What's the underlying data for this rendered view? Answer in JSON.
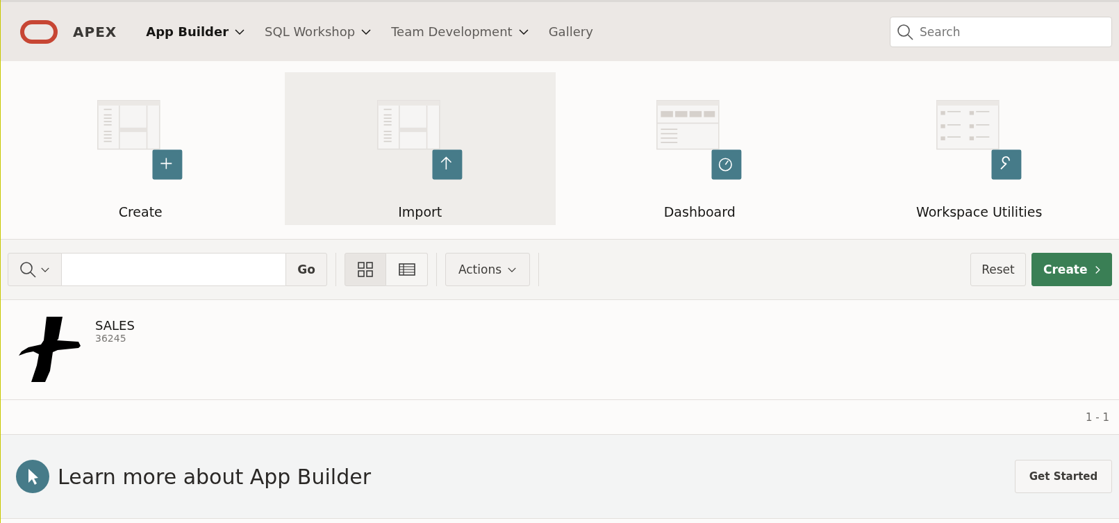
{
  "header": {
    "brand": "APEX",
    "nav": [
      {
        "label": "App Builder",
        "selected": true,
        "dropdown": true
      },
      {
        "label": "SQL Workshop",
        "selected": false,
        "dropdown": true
      },
      {
        "label": "Team Development",
        "selected": false,
        "dropdown": true
      },
      {
        "label": "Gallery",
        "selected": false,
        "dropdown": false
      }
    ],
    "search": {
      "placeholder": "Search"
    }
  },
  "tiles": [
    {
      "kind": "create",
      "label": "Create",
      "highlighted": false
    },
    {
      "kind": "import",
      "label": "Import",
      "highlighted": true
    },
    {
      "kind": "dashboard",
      "label": "Dashboard",
      "highlighted": false
    },
    {
      "kind": "utilities",
      "label": "Workspace Utilities",
      "highlighted": false
    }
  ],
  "toolbar": {
    "go": "Go",
    "views": [
      {
        "kind": "grid",
        "selected": true
      },
      {
        "kind": "table",
        "selected": false
      }
    ],
    "actions": "Actions",
    "reset": "Reset",
    "create": "Create"
  },
  "apps": [
    {
      "name": "SALES",
      "id": "36245"
    }
  ],
  "pagination": "1 - 1",
  "learn": {
    "title": "Learn more about App Builder",
    "button": "Get Started"
  }
}
